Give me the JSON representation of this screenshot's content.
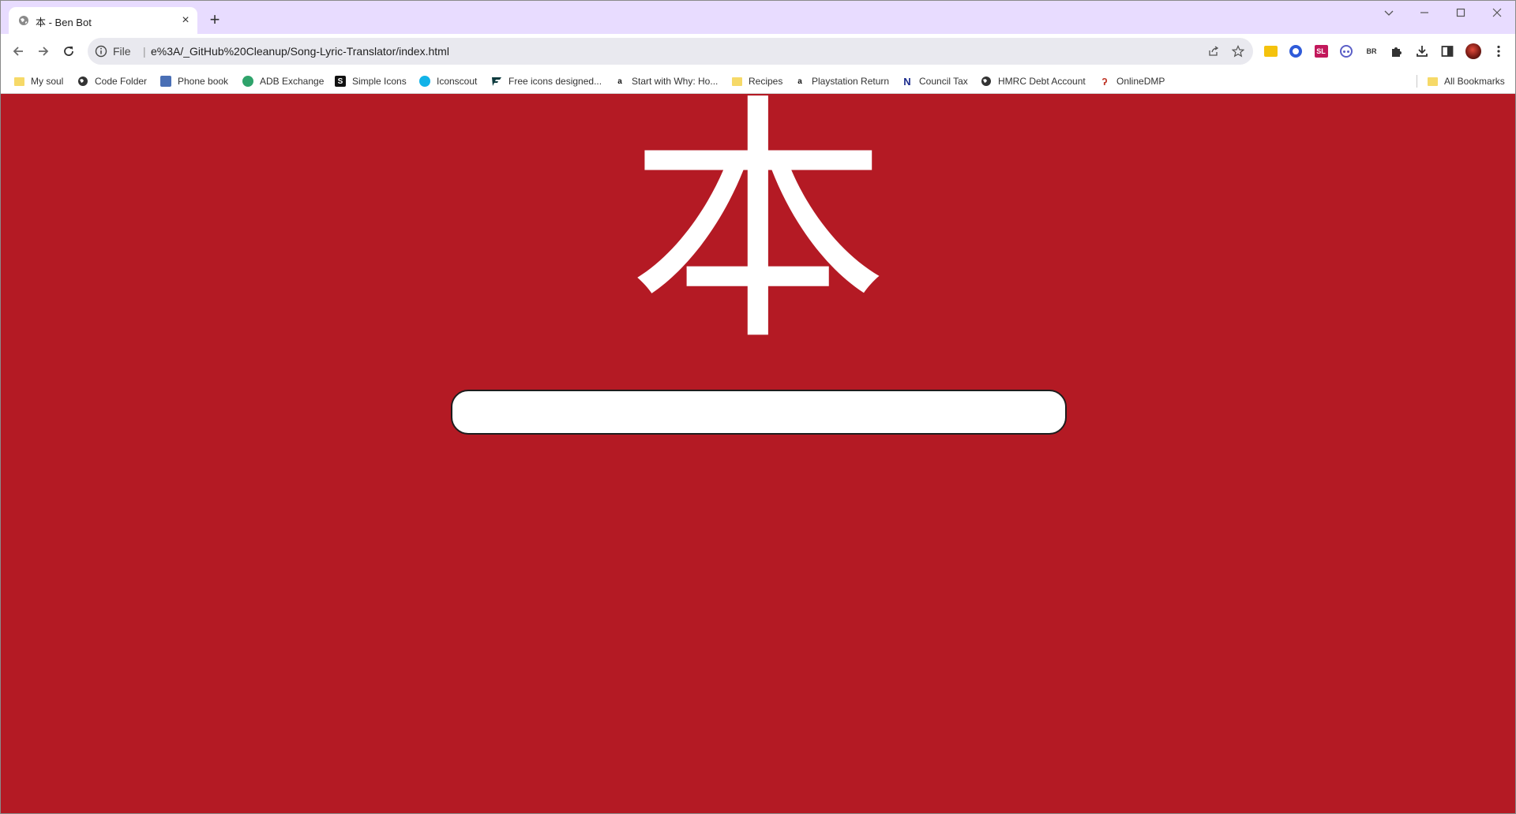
{
  "tab": {
    "title": "本 - Ben Bot",
    "close_label": "×",
    "new_tab_label": "+"
  },
  "omnibox": {
    "scheme": "File",
    "separator": "|",
    "url": "e%3A/_GitHub%20Cleanup/Song-Lyric-Translator/index.html"
  },
  "extensions": [
    "SL",
    "BR"
  ],
  "bookmarks": [
    {
      "label": "My soul",
      "icon": "folder-icon"
    },
    {
      "label": "Code Folder",
      "icon": "globe-icon"
    },
    {
      "label": "Phone book",
      "icon": "book-icon"
    },
    {
      "label": "ADB Exchange",
      "icon": "adb-icon"
    },
    {
      "label": "Simple Icons",
      "icon": "simple-icons-icon"
    },
    {
      "label": "Iconscout",
      "icon": "iconscout-icon"
    },
    {
      "label": "Free icons designed...",
      "icon": "flaticon-icon"
    },
    {
      "label": "Start with Why: Ho...",
      "icon": "amazon-icon"
    },
    {
      "label": "Recipes",
      "icon": "folder-icon"
    },
    {
      "label": "Playstation Return",
      "icon": "amazon-icon"
    },
    {
      "label": "Council Tax",
      "icon": "n-logo-icon"
    },
    {
      "label": "HMRC Debt Account",
      "icon": "globe-icon"
    },
    {
      "label": "OnlineDMP",
      "icon": "onlinedmp-icon"
    }
  ],
  "all_bookmarks": {
    "label": "All Bookmarks"
  },
  "page": {
    "heading": "本",
    "background": "#b41a24",
    "search_value": ""
  },
  "colors": {
    "tab_strip": "#e8dcff",
    "omnibox": "#e9e9ef"
  }
}
